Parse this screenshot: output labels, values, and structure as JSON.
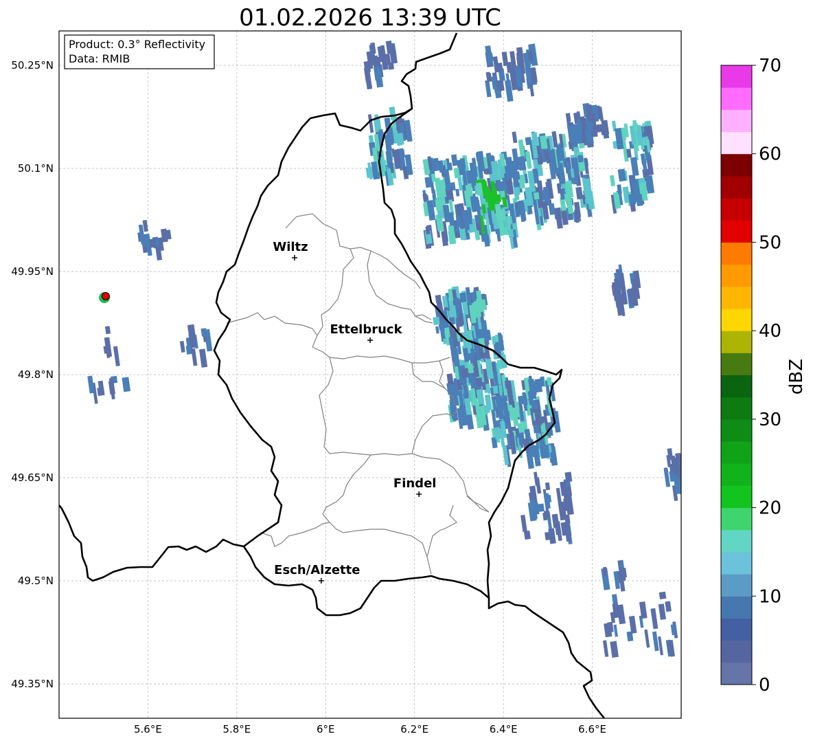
{
  "title": "01.02.2026 13:39 UTC",
  "info_box": {
    "line1": "Product: 0.3° Reflectivity",
    "line2": "Data: RMIB"
  },
  "map": {
    "lon_range": [
      5.4,
      6.8
    ],
    "lat_range": [
      49.3,
      50.3
    ],
    "x_ticks": [
      {
        "value": 5.6,
        "label": "5.6°E"
      },
      {
        "value": 5.8,
        "label": "5.8°E"
      },
      {
        "value": 6.0,
        "label": "6°E"
      },
      {
        "value": 6.2,
        "label": "6.2°E"
      },
      {
        "value": 6.4,
        "label": "6.4°E"
      },
      {
        "value": 6.6,
        "label": "6.6°E"
      }
    ],
    "y_ticks": [
      {
        "value": 50.25,
        "label": "50.25°N"
      },
      {
        "value": 50.1,
        "label": "50.1°N"
      },
      {
        "value": 49.95,
        "label": "49.95°N"
      },
      {
        "value": 49.8,
        "label": "49.8°N"
      },
      {
        "value": 49.65,
        "label": "49.65°N"
      },
      {
        "value": 49.5,
        "label": "49.5°N"
      },
      {
        "value": 49.35,
        "label": "49.35°N"
      }
    ],
    "grid": true,
    "cities": [
      {
        "name": "Wiltz",
        "lon": 5.93,
        "lat": 49.97
      },
      {
        "name": "Ettelbruck",
        "lon": 6.1,
        "lat": 49.85
      },
      {
        "name": "Findel",
        "lon": 6.21,
        "lat": 49.626
      },
      {
        "name": "Esch/Alzette",
        "lon": 5.99,
        "lat": 49.5
      }
    ],
    "radar_site": {
      "lon": 5.505,
      "lat": 49.914,
      "color": "#e00000"
    }
  },
  "colorbar": {
    "label": "dBZ",
    "min": 0,
    "max": 70,
    "step": 2.5,
    "ticks": [
      {
        "value": 0,
        "label": "0"
      },
      {
        "value": 10,
        "label": "10"
      },
      {
        "value": 20,
        "label": "20"
      },
      {
        "value": 30,
        "label": "30"
      },
      {
        "value": 40,
        "label": "40"
      },
      {
        "value": 50,
        "label": "50"
      },
      {
        "value": 60,
        "label": "60"
      },
      {
        "value": 70,
        "label": "70"
      }
    ],
    "colors": [
      "#6574a9",
      "#5565a0",
      "#4460a2",
      "#4678b0",
      "#5c9bc6",
      "#6bc2db",
      "#62d6c4",
      "#3ed46e",
      "#12c41e",
      "#10b41a",
      "#10a318",
      "#0e8c15",
      "#0d7a12",
      "#0a6410",
      "#477a10",
      "#adb404",
      "#ffd600",
      "#ffb600",
      "#ff9a00",
      "#ff7b00",
      "#e20000",
      "#c60000",
      "#a00000",
      "#7c0000",
      "#ffe0ff",
      "#ffb0ff",
      "#ff6cff",
      "#e83ae8"
    ]
  },
  "echo_colors": {
    "light": "#5a6fa8",
    "mid": "#4a7fb8",
    "cyan": "#5cc4cc",
    "green": "#1cc02a",
    "teal": "#5fd3be"
  }
}
